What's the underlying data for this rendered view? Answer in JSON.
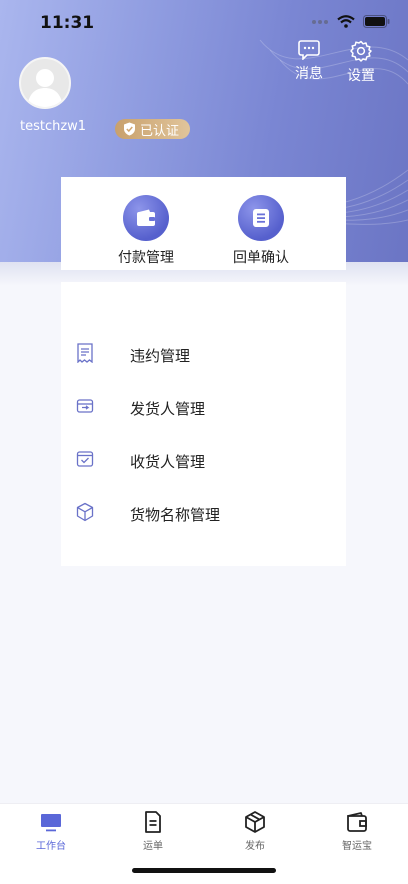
{
  "status_bar": {
    "time": "11:31"
  },
  "header": {
    "messages_label": "消息",
    "settings_label": "设置",
    "username": "testchzw1",
    "verified_label": "已认证"
  },
  "quick_actions": [
    {
      "label": "付款管理",
      "icon": "wallet-icon"
    },
    {
      "label": "回单确认",
      "icon": "document-icon"
    }
  ],
  "menu": [
    {
      "label": "违约管理",
      "icon": "receipt-icon"
    },
    {
      "label": "发货人管理",
      "icon": "outbox-icon"
    },
    {
      "label": "收货人管理",
      "icon": "inbox-check-icon"
    },
    {
      "label": "货物名称管理",
      "icon": "cube-icon"
    }
  ],
  "tabbar": [
    {
      "label": "工作台",
      "icon": "monitor-icon",
      "active": true
    },
    {
      "label": "运单",
      "icon": "document-icon",
      "active": false
    },
    {
      "label": "发布",
      "icon": "cube-icon",
      "active": false
    },
    {
      "label": "智运宝",
      "icon": "wallet-icon",
      "active": false
    }
  ],
  "colors": {
    "accent": "#5a67d8",
    "header_gradient_start": "#aab6ee",
    "header_gradient_end": "#6b75c4",
    "verified_badge": "#d4ad7d"
  }
}
